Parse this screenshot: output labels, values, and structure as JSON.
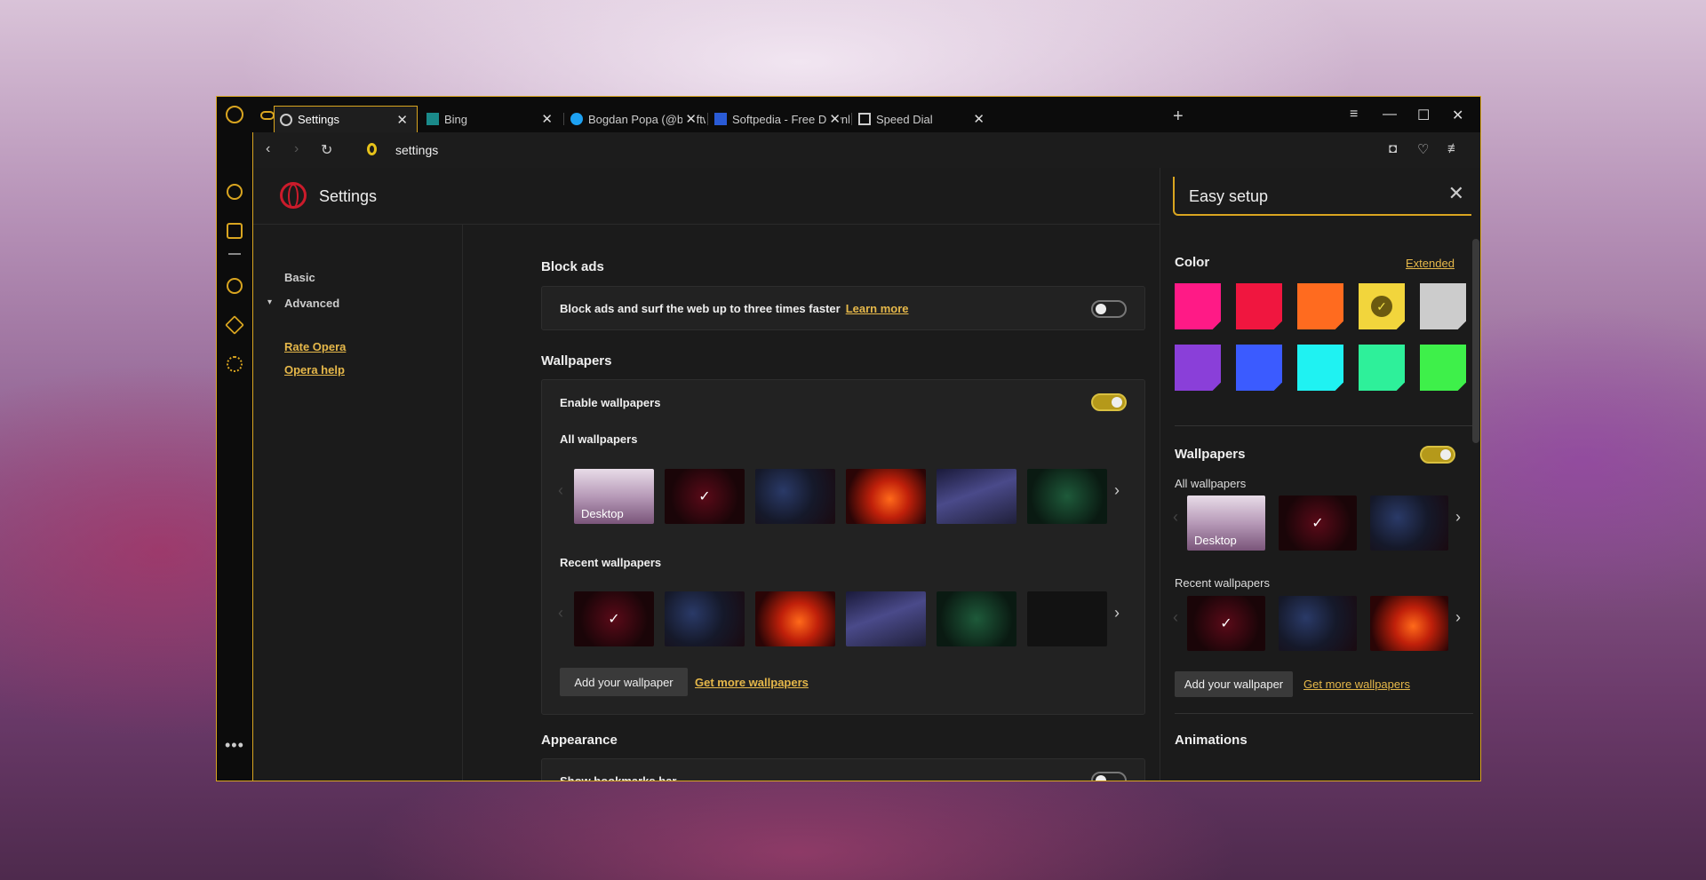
{
  "tabs": [
    {
      "label": "Settings"
    },
    {
      "label": "Bing"
    },
    {
      "label": "Bogdan Popa (@bgdftw) | T"
    },
    {
      "label": "Softpedia - Free Download"
    },
    {
      "label": "Speed Dial"
    }
  ],
  "address": {
    "url": "settings"
  },
  "settings": {
    "title": "Settings",
    "nav": {
      "basic": "Basic",
      "advanced": "Advanced",
      "rate": "Rate Opera",
      "help": "Opera help"
    },
    "block_ads": {
      "title": "Block ads",
      "text": "Block ads and surf the web up to three times faster",
      "learn_more": "Learn more",
      "enabled": false
    },
    "wallpapers": {
      "title": "Wallpapers",
      "enable_label": "Enable wallpapers",
      "enabled": true,
      "all_label": "All wallpapers",
      "recent_label": "Recent wallpapers",
      "desktop_label": "Desktop",
      "add_button": "Add your wallpaper",
      "get_more": "Get more wallpapers"
    },
    "appearance": {
      "title": "Appearance",
      "bookmarks_label": "Show bookmarks bar",
      "bookmarks_enabled": false
    }
  },
  "easy_setup": {
    "title": "Easy setup",
    "color_label": "Color",
    "extended_link": "Extended",
    "colors": [
      "#ff1a86",
      "#f0163f",
      "#ff6b1f",
      "#f2d53c",
      "#cccccc",
      "#8a3fd9",
      "#3b5bff",
      "#1ff2f2",
      "#2ef09a",
      "#3ef04a"
    ],
    "selected_color": "#f2d53c",
    "wallpapers_label": "Wallpapers",
    "wallpapers_enabled": true,
    "all_label": "All wallpapers",
    "recent_label": "Recent wallpapers",
    "desktop_label": "Desktop",
    "add_button": "Add your wallpaper",
    "get_more": "Get more wallpapers",
    "animations_label": "Animations"
  },
  "icons": {
    "check": "✓",
    "close": "✕",
    "chevron_right": "›",
    "chevron_left": "‹"
  }
}
